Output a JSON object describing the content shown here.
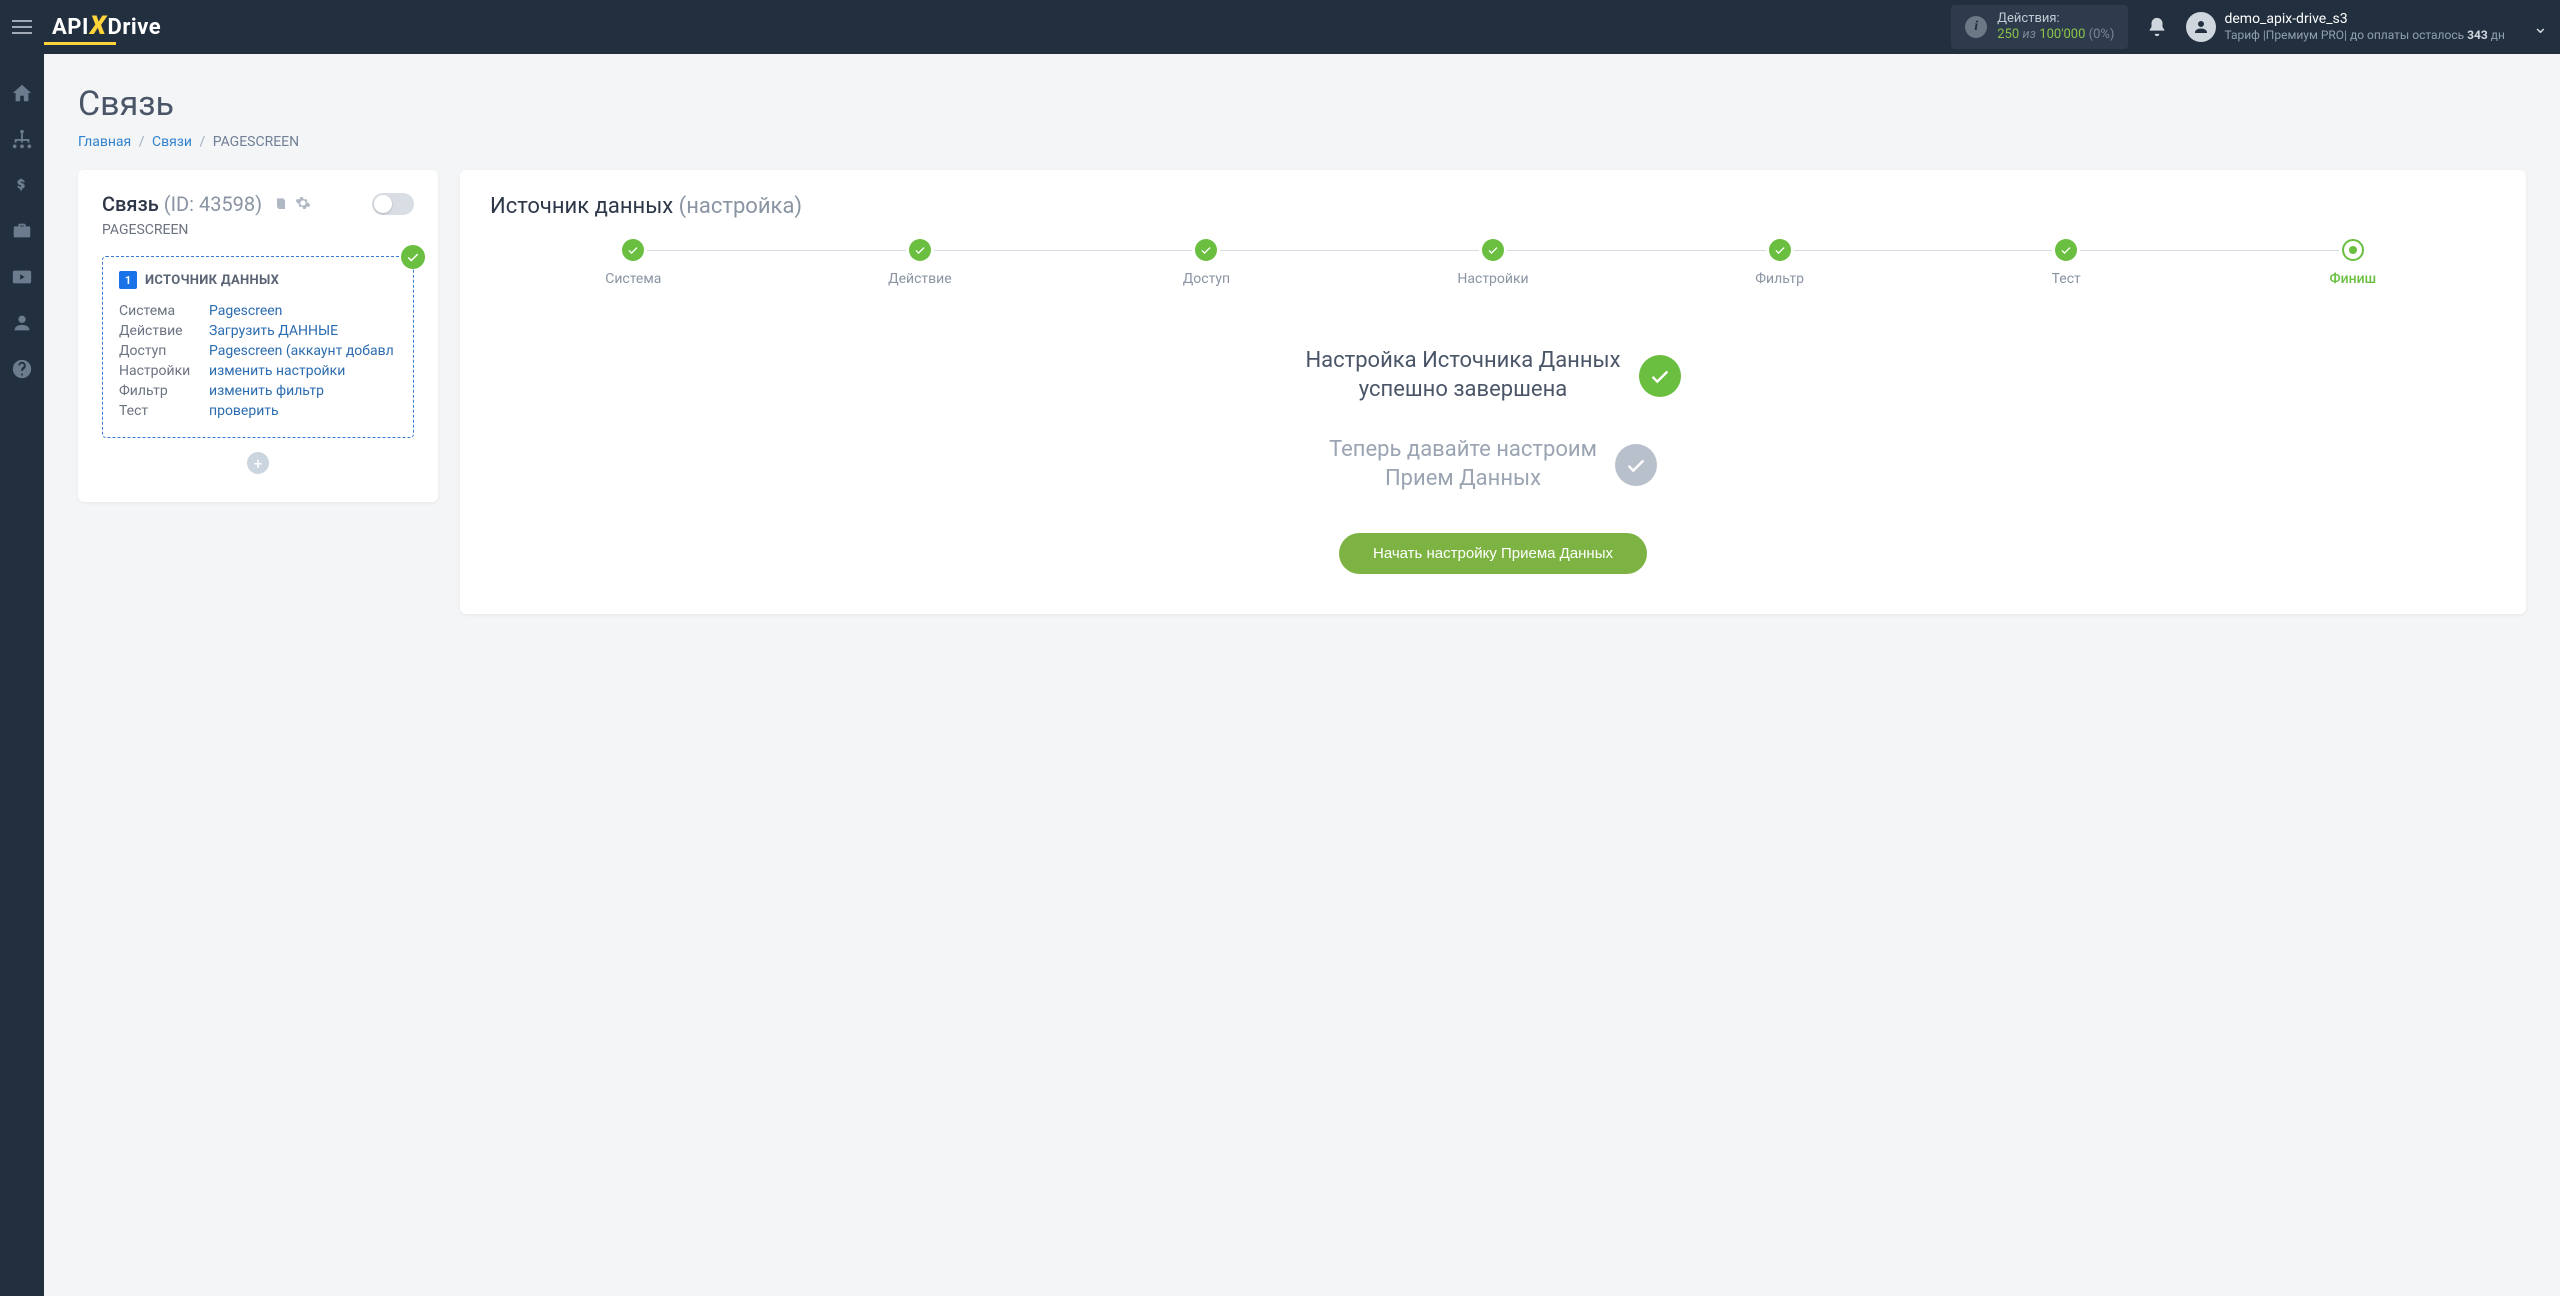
{
  "topbar": {
    "actions_label": "Действия:",
    "actions_used": "250",
    "actions_sep": "из",
    "actions_total": "100'000",
    "actions_pct": "(0%)",
    "user_name": "demo_apix-drive_s3",
    "plan_prefix": "Тариф |",
    "plan_name": "Премиум PRO",
    "plan_suffix": "| до оплаты осталось ",
    "days": "343",
    "days_unit": " дн"
  },
  "page": {
    "title": "Связь"
  },
  "breadcrumb": {
    "home": "Главная",
    "links": "Связи",
    "current": "PAGESCREEN"
  },
  "left": {
    "title": "Связь",
    "id": "(ID: 43598)",
    "name": "PAGESCREEN",
    "source_num": "1",
    "source_title": "ИСТОЧНИК ДАННЫХ",
    "rows": [
      {
        "key": "Система",
        "val": "Pagescreen"
      },
      {
        "key": "Действие",
        "val": "Загрузить ДАННЫЕ"
      },
      {
        "key": "Доступ",
        "val": "Pagescreen (аккаунт добавл"
      },
      {
        "key": "Настройки",
        "val": "изменить настройки"
      },
      {
        "key": "Фильтр",
        "val": "изменить фильтр"
      },
      {
        "key": "Тест",
        "val": "проверить"
      }
    ]
  },
  "right": {
    "header_main": "Источник данных",
    "header_dim": "(настройка)",
    "steps": [
      {
        "label": "Система",
        "state": "done"
      },
      {
        "label": "Действие",
        "state": "done"
      },
      {
        "label": "Доступ",
        "state": "done"
      },
      {
        "label": "Настройки",
        "state": "done"
      },
      {
        "label": "Фильтр",
        "state": "done"
      },
      {
        "label": "Тест",
        "state": "done"
      },
      {
        "label": "Финиш",
        "state": "current"
      }
    ],
    "status1_line1": "Настройка Источника Данных",
    "status1_line2": "успешно завершена",
    "status2_line1": "Теперь давайте настроим",
    "status2_line2": "Прием Данных",
    "button": "Начать настройку Приема Данных"
  }
}
